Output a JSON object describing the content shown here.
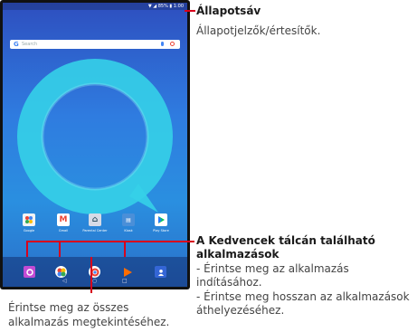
{
  "status_callout": {
    "title": "Állapotsáv",
    "text": "Állapotjelzők/értesítők."
  },
  "favorites_callout": {
    "title_line1": "A Kedvencek tálcán található",
    "title_line2": "alkalmazások",
    "line1": "- Érintse meg az alkalmazás",
    "line2": "indításához.",
    "line3": "- Érintse meg hosszan az alkalmazások",
    "line4": "áthelyezéséhez."
  },
  "all_apps_callout": {
    "line1": "Érintse meg az összes",
    "line2": "alkalmazás megtekintéséhez."
  },
  "tablet": {
    "status_icons": "▼ ◢ 85% ▮ 1:00",
    "search_logo": "G",
    "search_placeholder": "Search",
    "apps": [
      {
        "label": "Google",
        "icon": "google-folder-icon"
      },
      {
        "label": "Gmail",
        "icon": "gmail-icon"
      },
      {
        "label": "Parental Center",
        "icon": "parental-center-icon"
      },
      {
        "label": "Kiosk",
        "icon": "kiosk-icon"
      },
      {
        "label": "Play Store",
        "icon": "play-store-icon"
      }
    ],
    "dock": [
      {
        "icon": "camera-icon"
      },
      {
        "icon": "photos-icon"
      },
      {
        "icon": "all-apps-icon"
      },
      {
        "icon": "play-music-icon"
      },
      {
        "icon": "contacts-icon"
      }
    ],
    "nav": [
      {
        "glyph": "◁",
        "icon": "back-icon"
      },
      {
        "glyph": "○",
        "icon": "home-icon"
      },
      {
        "glyph": "□",
        "icon": "recents-icon"
      }
    ]
  },
  "colors": {
    "callout_line": "#d8001c",
    "wallpaper": "#2f7ce0"
  }
}
